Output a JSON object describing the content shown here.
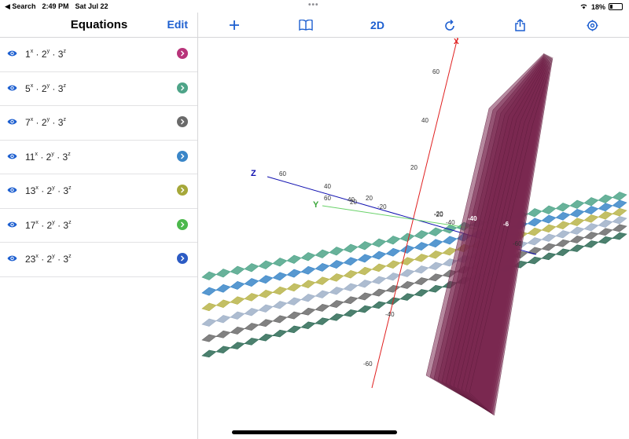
{
  "status": {
    "back": "◀ Search",
    "time": "2:49 PM",
    "date": "Sat Jul 22",
    "battery": "18%"
  },
  "sidebar": {
    "title": "Equations",
    "edit_label": "Edit",
    "equations": [
      {
        "base": "1",
        "color": "#b8347a"
      },
      {
        "base": "5",
        "color": "#4ea488"
      },
      {
        "base": "7",
        "color": "#6a6a6a"
      },
      {
        "base": "11",
        "color": "#3a86c8"
      },
      {
        "base": "13",
        "color": "#a6a83a"
      },
      {
        "base": "17",
        "color": "#4cb84c"
      },
      {
        "base": "23",
        "color": "#2c5bc4"
      }
    ],
    "eq_exponents": {
      "x": "x",
      "y": "y",
      "z": "z",
      "two": "2",
      "three": "3",
      "dot": "·"
    }
  },
  "toolbar": {
    "mode_label": "2D"
  },
  "axes": {
    "x_label": "X",
    "y_label": "Y",
    "z_label": "Z",
    "x_ticks": [
      "60",
      "40",
      "20",
      "-20",
      "-40",
      "-60"
    ],
    "z_ticks": [
      "60",
      "40",
      "20",
      "-20",
      "-40",
      "-60"
    ],
    "y_ticks": [
      "60",
      "40",
      "20",
      "-20",
      "-40",
      "-6"
    ],
    "colors": {
      "x": "#e02020",
      "y": "#6ad26a",
      "z": "#1010b0"
    }
  },
  "surfaces": [
    {
      "color": "#2d6a55",
      "offset": 0
    },
    {
      "color": "#6b6b6b",
      "offset": 1
    },
    {
      "color": "#9fb0c8",
      "offset": 2
    },
    {
      "color": "#b8b44a",
      "offset": 3
    },
    {
      "color": "#3a86c8",
      "offset": 4
    },
    {
      "color": "#4ea488",
      "offset": 5
    }
  ],
  "purple_color": "#7a2850"
}
